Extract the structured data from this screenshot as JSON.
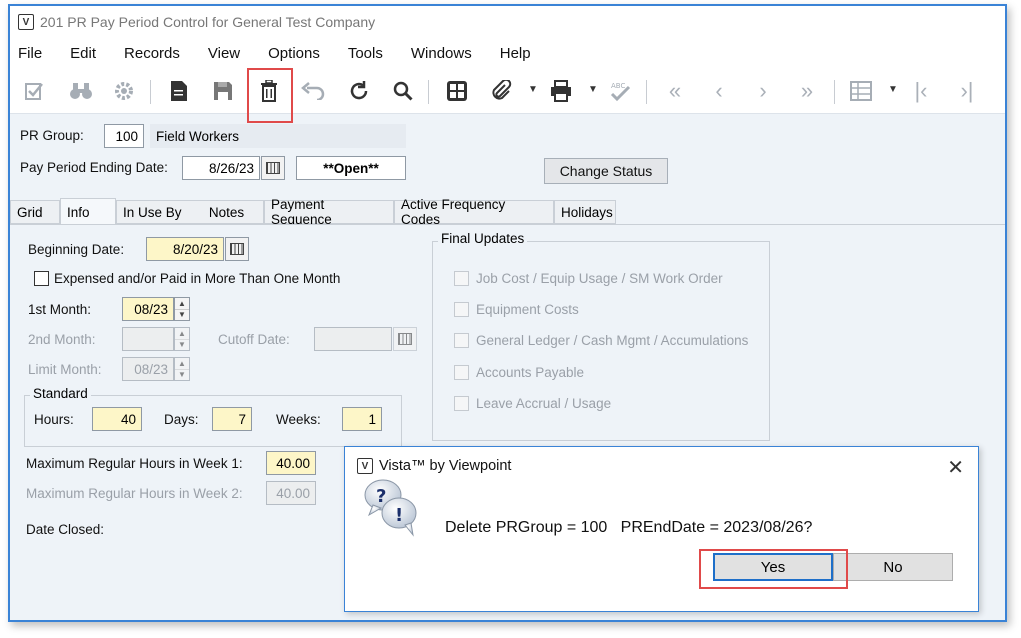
{
  "window": {
    "title": "201 PR Pay Period Control for General Test Company",
    "icon_text": "V"
  },
  "menu": [
    "File",
    "Edit",
    "Records",
    "View",
    "Options",
    "Tools",
    "Windows",
    "Help"
  ],
  "toolbar": {
    "icons": [
      "edit-check-icon",
      "binoculars-icon",
      "gear-icon",
      "new-document-icon",
      "save-icon",
      "delete-icon",
      "undo-icon",
      "refresh-icon",
      "search-icon",
      "calculator-icon",
      "attachment-icon",
      "print-icon",
      "spellcheck-icon",
      "first-record-icon",
      "previous-record-icon",
      "next-record-icon",
      "last-record-icon",
      "grid-icon",
      "first-icon",
      "last-icon"
    ]
  },
  "header": {
    "pr_group_label": "PR Group:",
    "pr_group_value": "100",
    "pr_group_desc": "Field Workers",
    "pay_period_label": "Pay Period Ending Date:",
    "pay_period_value": "8/26/23",
    "status_value": "**Open**",
    "change_status_label": "Change Status"
  },
  "tabs": [
    "Grid",
    "Info",
    "In Use By",
    "Notes",
    "Payment Sequence",
    "Active Frequency Codes",
    "Holidays"
  ],
  "info": {
    "beginning_date_label": "Beginning Date:",
    "beginning_date_value": "8/20/23",
    "multi_month_label": "Expensed and/or Paid in More Than One Month",
    "first_month_label": "1st Month:",
    "first_month_value": "08/23",
    "second_month_label": "2nd Month:",
    "second_month_value": "",
    "cutoff_label": "Cutoff Date:",
    "cutoff_value": "",
    "limit_month_label": "Limit Month:",
    "limit_month_value": "08/23",
    "standard_title": "Standard",
    "hours_label": "Hours:",
    "hours_value": "40",
    "days_label": "Days:",
    "days_value": "7",
    "weeks_label": "Weeks:",
    "weeks_value": "1",
    "max_week1_label": "Maximum Regular Hours in Week 1:",
    "max_week1_value": "40.00",
    "max_week2_label": "Maximum Regular Hours in Week 2:",
    "max_week2_value": "40.00",
    "date_closed_label": "Date Closed:",
    "final_updates_title": "Final Updates",
    "final_updates": [
      "Job Cost / Equip Usage / SM Work Order",
      "Equipment Costs",
      "General Ledger / Cash Mgmt / Accumulations",
      "Accounts Payable",
      "Leave Accrual / Usage"
    ]
  },
  "dialog": {
    "title": "Vista™ by Viewpoint",
    "message": "Delete PRGroup = 100   PREndDate = 2023/08/26?",
    "yes_label": "Yes",
    "no_label": "No"
  }
}
